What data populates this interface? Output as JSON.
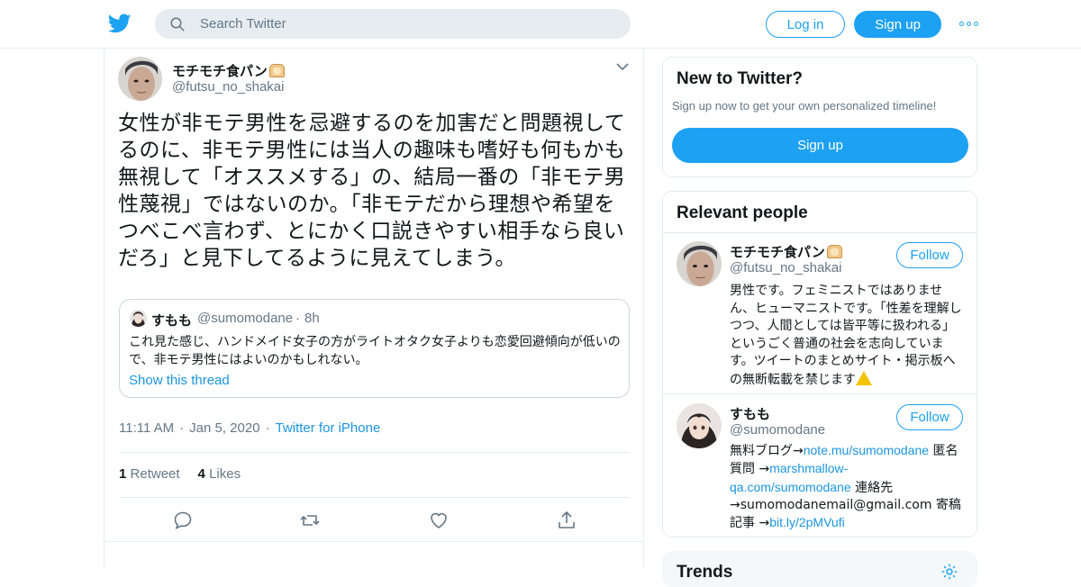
{
  "header": {
    "logo_icon": "twitter-bird-icon",
    "search_placeholder": "Search Twitter",
    "login_label": "Log in",
    "signup_label": "Sign up",
    "more_icon": "more-dots-icon",
    "brand_color": "#1da1f2"
  },
  "tweet": {
    "author_name": "モチモチ食パン",
    "author_handle": "@futsu_no_shakai",
    "text": "女性が非モテ男性を忌避するのを加害だと問題視してるのに、非モテ男性には当人の趣味も嗜好も何もかも無視して「オススメする」の、結局一番の「非モテ男性蔑視」ではないのか。「非モテだから理想や希望をつべこべ言わず、とにかく口説きやすい相手なら良いだろ」と見下してるように見えてしまう。",
    "quote": {
      "name": "すもも",
      "handle": "@sumomodane",
      "dot": "·",
      "time": "8h",
      "text": "これ見た感じ、ハンドメイド女子の方がライトオタク女子よりも恋愛回避傾向が低いので、非モテ男性にはよいのかもしれない。",
      "link": "Show this thread"
    },
    "time": "11:11 AM",
    "date": "Jan 5, 2020",
    "source": "Twitter for iPhone",
    "sep": "·",
    "retweets_count": "1",
    "retweets_label": "Retweet",
    "likes_count": "4",
    "likes_label": "Likes"
  },
  "sidebar": {
    "new_title": "New to Twitter?",
    "new_sub": "Sign up now to get your own personalized timeline!",
    "new_signup": "Sign up",
    "relevant_title": "Relevant people",
    "people": [
      {
        "name": "モチモチ食パン",
        "handle": "@futsu_no_shakai",
        "follow": "Follow",
        "bio": "男性です。フェミニストではありません、ヒューマニストです。「性差を理解しつつ、人間としては皆平等に扱われる」というごく普通の社会を志向しています。ツイートのまとめサイト・掲示板への無断転載を禁じます"
      },
      {
        "name": "すもも",
        "handle": "@sumomodane",
        "follow": "Follow",
        "bio_1": "無料ブログ→",
        "bio_link_1": "note.mu/sumomodane",
        "bio_2": " 匿名質問 →",
        "bio_link_2": "marshmallow-qa.com/sumomodane",
        "bio_3": " 連絡先→sumomodanemail@gmail.com 寄稿記事 →",
        "bio_link_3": "bit.ly/2pMVufi"
      }
    ],
    "trends_title": "Trends"
  }
}
